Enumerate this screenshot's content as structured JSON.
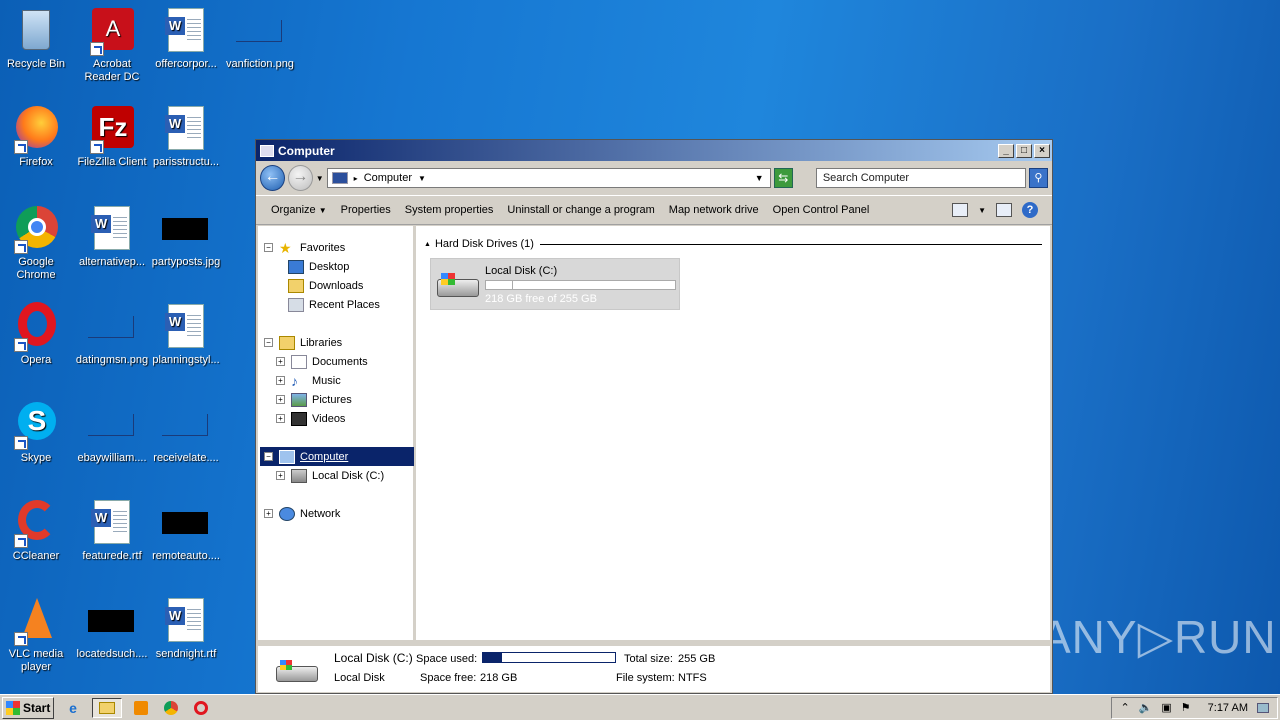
{
  "desktop": {
    "icons": [
      {
        "label": "Recycle Bin",
        "icon": "recycle-bin-icon"
      },
      {
        "label": "Acrobat Reader DC",
        "icon": "acrobat-icon"
      },
      {
        "label": "offercorpor...",
        "icon": "word-doc-icon"
      },
      {
        "label": "vanfiction.png",
        "icon": "image-file-icon"
      },
      {
        "label": "Firefox",
        "icon": "firefox-icon"
      },
      {
        "label": "FileZilla Client",
        "icon": "filezilla-icon"
      },
      {
        "label": "parisstructu...",
        "icon": "word-doc-icon"
      },
      {
        "label": "Google Chrome",
        "icon": "chrome-icon"
      },
      {
        "label": "alternativep...",
        "icon": "word-doc-icon"
      },
      {
        "label": "partyposts.jpg",
        "icon": "image-file-icon"
      },
      {
        "label": "Opera",
        "icon": "opera-icon"
      },
      {
        "label": "datingmsn.png",
        "icon": "image-file-icon"
      },
      {
        "label": "planningstyl...",
        "icon": "word-doc-icon"
      },
      {
        "label": "Skype",
        "icon": "skype-icon"
      },
      {
        "label": "ebaywilliam....",
        "icon": "image-file-icon"
      },
      {
        "label": "receivelate....",
        "icon": "image-file-icon"
      },
      {
        "label": "CCleaner",
        "icon": "ccleaner-icon"
      },
      {
        "label": "featurede.rtf",
        "icon": "word-doc-icon"
      },
      {
        "label": "remoteauto....",
        "icon": "image-file-icon"
      },
      {
        "label": "VLC media player",
        "icon": "vlc-icon"
      },
      {
        "label": "locatedsuch....",
        "icon": "image-file-icon"
      },
      {
        "label": "sendnight.rtf",
        "icon": "word-doc-icon"
      }
    ]
  },
  "window": {
    "title": "Computer",
    "address": "Computer",
    "search_placeholder": "Search Computer",
    "toolbar": [
      "Organize",
      "Properties",
      "System properties",
      "Uninstall or change a program",
      "Map network drive",
      "Open Control Panel"
    ],
    "nav": {
      "favorites": "Favorites",
      "desktop": "Desktop",
      "downloads": "Downloads",
      "recent": "Recent Places",
      "libraries": "Libraries",
      "documents": "Documents",
      "music": "Music",
      "pictures": "Pictures",
      "videos": "Videos",
      "computer": "Computer",
      "local_disk": "Local Disk (C:)",
      "network": "Network"
    },
    "group_header": "Hard Disk Drives (1)",
    "drive": {
      "name": "Local Disk (C:)",
      "free_text": "218 GB free of 255 GB",
      "used_fraction": 0.145
    },
    "details": {
      "name": "Local Disk",
      "letter": "(C:)",
      "type": "Local Disk",
      "space_used_label": "Space used:",
      "space_free_label": "Space free:",
      "space_free": "218 GB",
      "total_size_label": "Total size:",
      "total_size": "255 GB",
      "file_system_label": "File system:",
      "file_system": "NTFS"
    }
  },
  "taskbar": {
    "start_label": "Start",
    "clock": "7:17 AM"
  },
  "watermark": "ANY▷RUN"
}
